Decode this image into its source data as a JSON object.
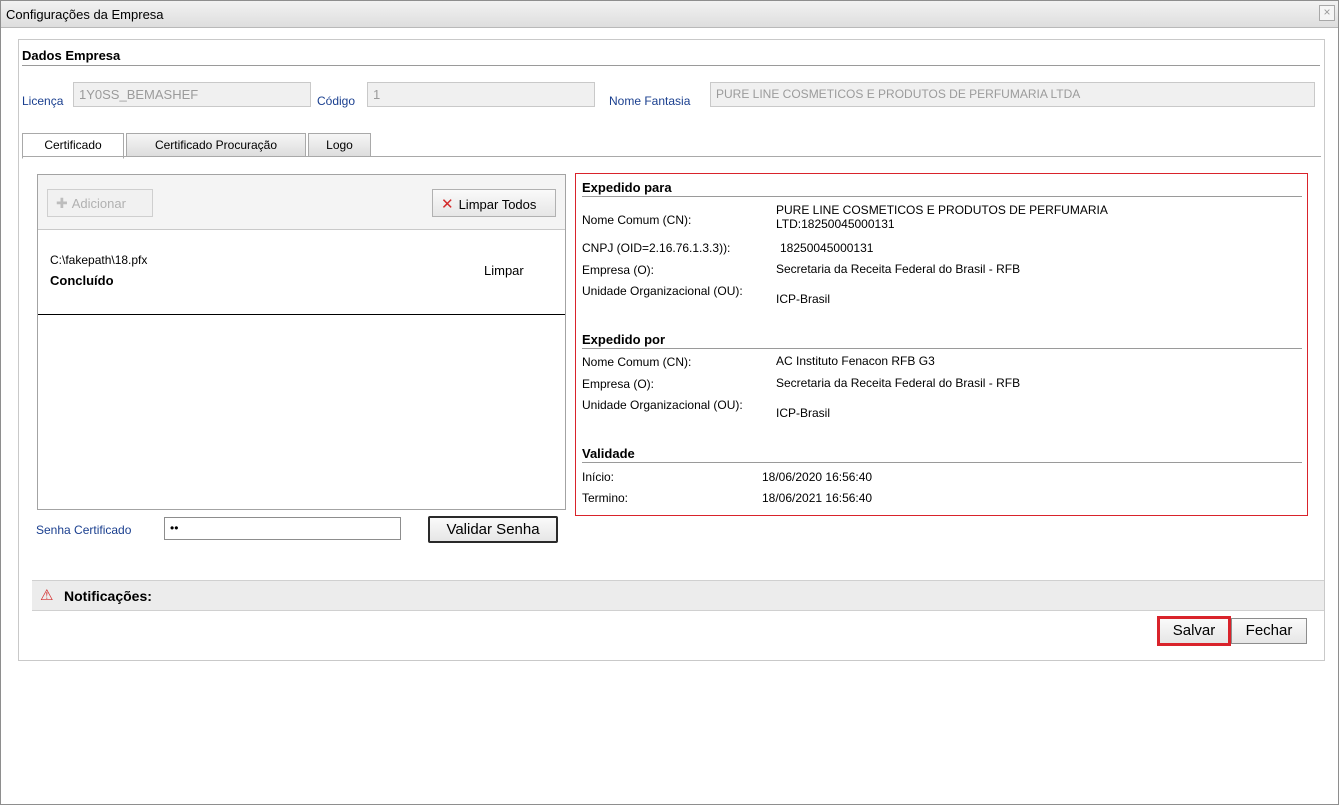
{
  "window": {
    "title": "Configurações da Empresa",
    "close_glyph": "×"
  },
  "company": {
    "section_title": "Dados Empresa",
    "license_label": "Licença",
    "license_value": "1Y0SS_BEMASHEF",
    "code_label": "Código",
    "code_value": "1",
    "trade_name_label": "Nome Fantasia",
    "trade_name_value": "PURE LINE COSMETICOS E PRODUTOS DE PERFUMARIA LTDA"
  },
  "tabs": [
    {
      "label": "Certificado",
      "active": true
    },
    {
      "label": "Certificado Procuração",
      "active": false
    },
    {
      "label": "Logo",
      "active": false
    }
  ],
  "upload": {
    "add_label": "Adicionar",
    "clear_all_label": "Limpar Todos",
    "file_path": "C:\\fakepath\\18.pfx",
    "file_status": "Concluído",
    "file_clear_label": "Limpar"
  },
  "certificate": {
    "issued_to_title": "Expedido para",
    "issued_to": {
      "cn_label": "Nome Comum (CN):",
      "cn_value_line1": "PURE LINE COSMETICOS E PRODUTOS DE PERFUMARIA",
      "cn_value_line2": "LTD:18250045000131",
      "cnpj_label": "CNPJ (OID=2.16.76.1.3.3)):",
      "cnpj_value": "18250045000131",
      "org_label": "Empresa (O):",
      "org_value": "Secretaria da Receita Federal do Brasil - RFB",
      "ou_label": "Unidade Organizacional (OU):",
      "ou_value": "ICP-Brasil"
    },
    "issued_by_title": "Expedido por",
    "issued_by": {
      "cn_label": "Nome Comum (CN):",
      "cn_value": "AC Instituto Fenacon RFB G3",
      "org_label": "Empresa (O):",
      "org_value": "Secretaria da Receita Federal do Brasil - RFB",
      "ou_label": "Unidade Organizacional (OU):",
      "ou_value": "ICP-Brasil"
    },
    "validity_title": "Validade",
    "validity": {
      "start_label": "Início:",
      "start_value": "18/06/2020 16:56:40",
      "end_label": "Termino:",
      "end_value": "18/06/2021 16:56:40"
    }
  },
  "password": {
    "label": "Senha Certificado",
    "value": "••",
    "validate_label": "Validar Senha"
  },
  "notifications": {
    "icon": "warning-icon",
    "label": "Notificações:"
  },
  "footer": {
    "save_label": "Salvar",
    "close_label": "Fechar"
  },
  "colors": {
    "highlight": "#d9232b",
    "label_blue": "#1a3f8f"
  }
}
